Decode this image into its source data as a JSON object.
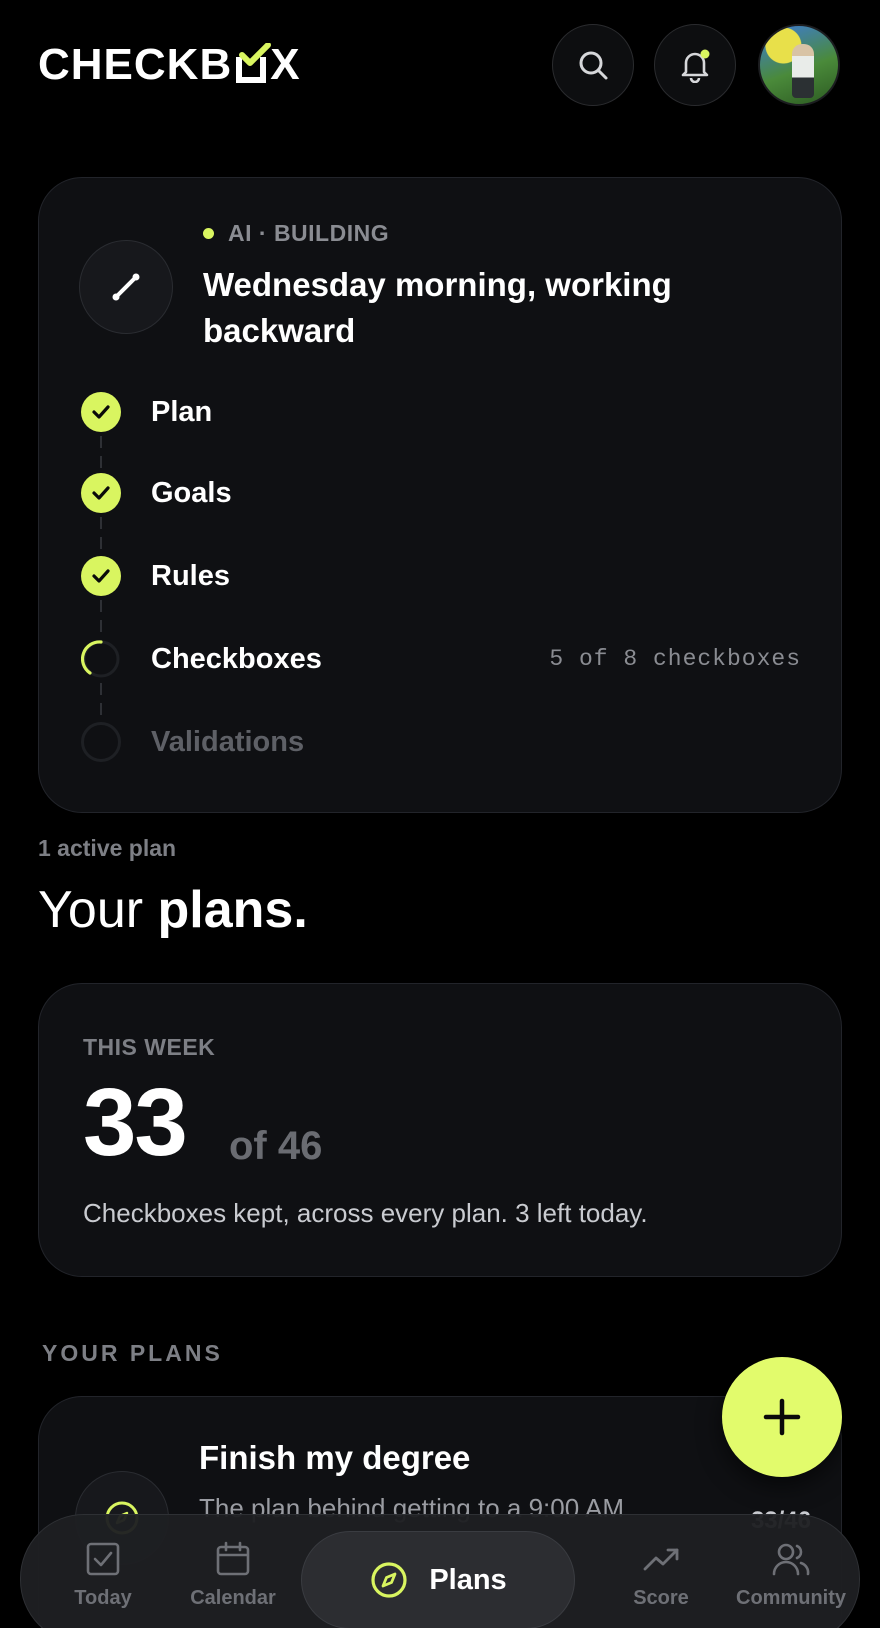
{
  "header": {
    "logo_left": "CHECKB",
    "logo_right": "X"
  },
  "ai_card": {
    "status": "AI · BUILDING",
    "title": "Wednesday morning, working backward",
    "steps": [
      {
        "label": "Plan",
        "state": "done"
      },
      {
        "label": "Goals",
        "state": "done"
      },
      {
        "label": "Rules",
        "state": "done"
      },
      {
        "label": "Checkboxes",
        "state": "in-progress",
        "meta": "5 of 8 checkboxes"
      },
      {
        "label": "Validations",
        "state": "pending"
      }
    ]
  },
  "plans_header": {
    "active_count": "1 active plan",
    "title_light": "Your",
    "title_bold": "plans."
  },
  "week_card": {
    "label": "THIS WEEK",
    "kept": "33",
    "of_total": "of 46",
    "description": "Checkboxes kept, across every plan. 3 left today."
  },
  "plans_section": {
    "label": "YOUR PLANS",
    "plans": [
      {
        "title": "Finish my degree",
        "description": "The plan behind getting to a 9:00 AM",
        "count": "33/46"
      }
    ]
  },
  "nav": {
    "items": [
      {
        "label": "Today",
        "icon": "today-icon"
      },
      {
        "label": "Calendar",
        "icon": "calendar-icon"
      },
      {
        "label": "Plans",
        "icon": "compass-icon",
        "active": true
      },
      {
        "label": "Score",
        "icon": "trending-up-icon"
      },
      {
        "label": "Community",
        "icon": "users-icon"
      }
    ]
  },
  "colors": {
    "accent": "#d9f560",
    "fab": "#e2fb6c",
    "background": "#000000",
    "card": "#0f1013"
  }
}
